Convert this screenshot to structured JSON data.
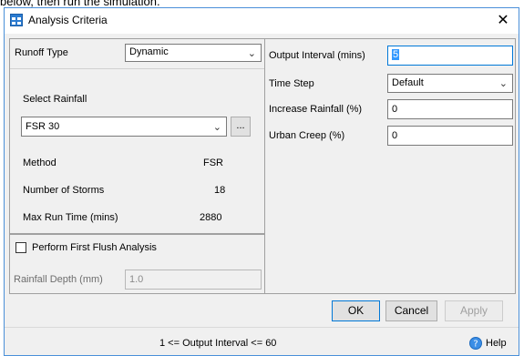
{
  "context_text": "below, then run the simulation.",
  "window": {
    "title": "Analysis Criteria",
    "close_label": "✕"
  },
  "left": {
    "runoff_type_label": "Runoff Type",
    "runoff_type_value": "Dynamic",
    "select_rainfall_label": "Select Rainfall",
    "rainfall_value": "FSR 30",
    "browse_label": "...",
    "method_label": "Method",
    "method_value": "FSR",
    "storms_label": "Number of Storms",
    "storms_value": "18",
    "max_run_label": "Max Run Time (mins)",
    "max_run_value": "2880",
    "first_flush_label": "Perform First Flush Analysis",
    "first_flush_checked": false,
    "rainfall_depth_label": "Rainfall Depth (mm)",
    "rainfall_depth_value": "1.0"
  },
  "right": {
    "output_interval_label": "Output Interval (mins)",
    "output_interval_value": "5",
    "time_step_label": "Time Step",
    "time_step_value": "Default",
    "increase_rainfall_label": "Increase Rainfall (%)",
    "increase_rainfall_value": "0",
    "urban_creep_label": "Urban Creep (%)",
    "urban_creep_value": "0"
  },
  "buttons": {
    "ok": "OK",
    "cancel": "Cancel",
    "apply": "Apply"
  },
  "status": {
    "hint": "1 <= Output Interval <= 60",
    "help": "Help"
  }
}
